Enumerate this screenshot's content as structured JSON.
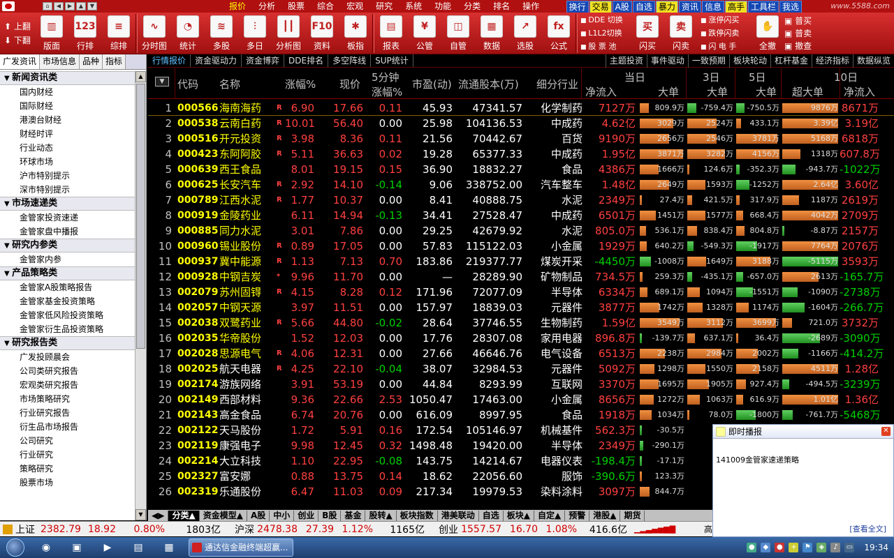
{
  "menubar": {
    "menus": [
      "报价",
      "分析",
      "股票",
      "综合",
      "宏观",
      "研究",
      "系统",
      "功能",
      "分类",
      "排名",
      "操作"
    ],
    "active_menu": "报价",
    "quick": [
      "换行",
      "交易",
      "A股",
      "自选",
      "暴力",
      "资讯",
      "信息",
      "高手",
      "工具栏",
      "我选"
    ],
    "site": "www.5588.com"
  },
  "toolbar": {
    "page_up": "上翻",
    "page_down": "下翻",
    "buttons": [
      {
        "label": "版面",
        "icon": "layout-icon"
      },
      {
        "label": "行排",
        "icon": "row-sort-icon"
      },
      {
        "label": "综排",
        "icon": "combined-sort-icon"
      },
      {
        "label": "分时图",
        "icon": "intraday-chart-icon"
      },
      {
        "label": "统计",
        "icon": "pie-stat-icon"
      },
      {
        "label": "多股",
        "icon": "multi-stock-icon"
      },
      {
        "label": "多日",
        "icon": "multi-day-icon"
      },
      {
        "label": "分析图",
        "icon": "candlestick-icon"
      },
      {
        "label": "资料",
        "icon": "f10-icon"
      },
      {
        "label": "板指",
        "icon": "sector-index-icon"
      },
      {
        "label": "报表",
        "icon": "report-icon"
      },
      {
        "label": "公管",
        "icon": "public-mgmt-icon"
      },
      {
        "label": "自管",
        "icon": "self-mgmt-icon"
      },
      {
        "label": "数据",
        "icon": "data-icon"
      },
      {
        "label": "选股",
        "icon": "stock-pick-icon"
      },
      {
        "label": "公式",
        "icon": "formula-icon"
      }
    ],
    "multi1": [
      "DDE 切换",
      "L1L2切换",
      "股 票 池"
    ],
    "buttons2": [
      {
        "label": "闪买",
        "icon": "flash-buy-icon",
        "glyph": "买"
      },
      {
        "label": "闪卖",
        "icon": "flash-sell-icon",
        "glyph": "卖"
      }
    ],
    "multi2": [
      "涨停闪买",
      "跌停闪卖",
      "闪 电 手"
    ],
    "button3": {
      "label": "全撤",
      "icon": "cancel-all-icon"
    },
    "trade": [
      "普买",
      "普卖",
      "撤查"
    ]
  },
  "sidebar": {
    "tabs": [
      "广发资讯",
      "市场信息",
      "品种",
      "指标"
    ],
    "sections": [
      {
        "title": "新闻资讯类",
        "items": [
          "国内财经",
          "国际财经",
          "港澳台财经",
          "财经时评",
          "行业动态",
          "环球市场",
          "沪市特别提示",
          "深市特别提示"
        ]
      },
      {
        "title": "市场速递类",
        "items": [
          "金管家投资速递",
          "金管家盘中播报"
        ]
      },
      {
        "title": "研究内参类",
        "items": [
          "金管家内参"
        ]
      },
      {
        "title": "产品策略类",
        "items": [
          "金管家A股策略报告",
          "金管家基金投资策略",
          "金管家低风险投资策略",
          "金管家衍生品投资策略"
        ]
      },
      {
        "title": "研究报告类",
        "items": [
          "广发投顾晨会",
          "公司类研究报告",
          "宏观类研究报告",
          "市场策略研究",
          "行业研究报告",
          "衍生品市场报告",
          "公司研究",
          "行业研究",
          "策略研究",
          "股票市场"
        ]
      }
    ]
  },
  "subtabs": [
    "行情报价",
    "资金驱动力",
    "资金博弈",
    "DDE排名",
    "多空阵线",
    "SUP统计"
  ],
  "subtabs_right": [
    "主题投资",
    "事件驱动",
    "一致预期",
    "板块轮动",
    "杠杆基金",
    "经济指标",
    "数据纵览"
  ],
  "table": {
    "headers": {
      "code": "代码",
      "name": "名称",
      "pct": "涨幅%",
      "price": "现价",
      "min5_top": "5分钟",
      "min5_bottom": "涨幅%",
      "pe": "市盈(动)",
      "float": "流通股本(万)",
      "industry": "细分行业",
      "today": "当日",
      "net": "净流入",
      "big": "大单",
      "d3": "3日",
      "d3big": "大单",
      "d5": "5日",
      "d5big": "大单",
      "d10": "10日",
      "superbig": "超大单",
      "net10": "净流入"
    },
    "rows": [
      {
        "no": "1",
        "code": "000566",
        "name": "海南海药",
        "tag": "R",
        "pct": "6.90",
        "price": "17.66",
        "m5": "0.11",
        "pe": "45.93",
        "float": "47341.57",
        "ind": "化学制药",
        "net": "7127万",
        "big": "809.9万",
        "d3": "-759.4万",
        "d5": "-750.5万",
        "sb": "9876万",
        "n10": "8671万"
      },
      {
        "no": "2",
        "code": "000538",
        "name": "云南白药",
        "tag": "R",
        "pct": "10.01",
        "price": "56.40",
        "m5": "0.00",
        "pe": "25.98",
        "float": "104136.53",
        "ind": "中成药",
        "net": "4.62亿",
        "big": "3029万",
        "d3": "2524万",
        "d5": "433.1万",
        "sb": "3.39亿",
        "n10": "3.19亿"
      },
      {
        "no": "3",
        "code": "000516",
        "name": "开元投资",
        "tag": "R",
        "pct": "3.98",
        "price": "8.36",
        "m5": "0.11",
        "pe": "21.56",
        "float": "70442.67",
        "ind": "百货",
        "net": "9190万",
        "big": "2656万",
        "d3": "2546万",
        "d5": "3781万",
        "sb": "5168万",
        "n10": "6818万"
      },
      {
        "no": "4",
        "code": "000423",
        "name": "东阿阿胶",
        "tag": "R",
        "pct": "5.11",
        "price": "36.63",
        "m5": "0.02",
        "pe": "19.28",
        "float": "65377.33",
        "ind": "中成药",
        "net": "1.95亿",
        "big": "3871万",
        "d3": "3282万",
        "d5": "4156万",
        "sb": "1318万",
        "n10": "607.8万"
      },
      {
        "no": "5",
        "code": "000639",
        "name": "西王食品",
        "tag": "",
        "pct": "8.01",
        "price": "19.15",
        "m5": "0.15",
        "pe": "36.90",
        "float": "18832.27",
        "ind": "食品",
        "net": "4386万",
        "big": "1666万",
        "d3": "124.6万",
        "d5": "-352.3万",
        "sb": "-943.7万",
        "n10": "-1022万"
      },
      {
        "no": "6",
        "code": "000625",
        "name": "长安汽车",
        "tag": "R",
        "pct": "2.92",
        "price": "14.10",
        "m5": "-0.14",
        "pe": "9.06",
        "float": "338752.00",
        "ind": "汽车整车",
        "net": "1.48亿",
        "big": "2649万",
        "d3": "1593万",
        "d5": "-1252万",
        "sb": "2.64亿",
        "n10": "3.60亿"
      },
      {
        "no": "7",
        "code": "000789",
        "name": "江西水泥",
        "tag": "R",
        "pct": "1.77",
        "price": "10.37",
        "m5": "0.00",
        "pe": "8.41",
        "float": "40888.75",
        "ind": "水泥",
        "net": "2349万",
        "big": "27.4万",
        "d3": "421.5万",
        "d5": "317.9万",
        "sb": "1187万",
        "n10": "2619万"
      },
      {
        "no": "8",
        "code": "000919",
        "name": "金陵药业",
        "tag": "",
        "pct": "6.11",
        "price": "14.94",
        "m5": "-0.13",
        "pe": "34.41",
        "float": "27528.47",
        "ind": "中成药",
        "net": "6501万",
        "big": "1451万",
        "d3": "1577万",
        "d5": "668.4万",
        "sb": "4042万",
        "n10": "2709万"
      },
      {
        "no": "9",
        "code": "000885",
        "name": "同力水泥",
        "tag": "",
        "pct": "3.01",
        "price": "7.86",
        "m5": "0.00",
        "pe": "29.25",
        "float": "42679.92",
        "ind": "水泥",
        "net": "805.0万",
        "big": "536.1万",
        "d3": "838.4万",
        "d5": "804.8万",
        "sb": "-8.87万",
        "n10": "2157万"
      },
      {
        "no": "10",
        "code": "000960",
        "name": "锡业股份",
        "tag": "R",
        "pct": "0.89",
        "price": "17.05",
        "m5": "0.00",
        "pe": "57.83",
        "float": "115122.03",
        "ind": "小金属",
        "net": "1929万",
        "big": "640.2万",
        "d3": "-549.3万",
        "d5": "-1917万",
        "sb": "7764万",
        "n10": "2076万"
      },
      {
        "no": "11",
        "code": "000937",
        "name": "冀中能源",
        "tag": "R",
        "pct": "1.13",
        "price": "7.13",
        "m5": "0.70",
        "pe": "183.86",
        "float": "219377.77",
        "ind": "煤炭开采",
        "net": "-4450万",
        "big": "-1008万",
        "d3": "1649万",
        "d5": "3188万",
        "sb": "-5115万",
        "n10": "3593万"
      },
      {
        "no": "12",
        "code": "000928",
        "name": "中钢吉炭",
        "tag": "*",
        "pct": "9.96",
        "price": "11.70",
        "m5": "0.00",
        "pe": "—",
        "float": "28289.90",
        "ind": "矿物制品",
        "net": "734.5万",
        "big": "259.3万",
        "d3": "-435.1万",
        "d5": "-657.0万",
        "sb": "2613万",
        "n10": "-165.7万"
      },
      {
        "no": "13",
        "code": "002079",
        "name": "苏州固锝",
        "tag": "R",
        "pct": "4.15",
        "price": "8.28",
        "m5": "0.12",
        "pe": "171.96",
        "float": "72077.09",
        "ind": "半导体",
        "net": "6334万",
        "big": "689.1万",
        "d3": "1094万",
        "d5": "-1551万",
        "sb": "-1090万",
        "n10": "-2738万"
      },
      {
        "no": "14",
        "code": "002057",
        "name": "中钢天源",
        "tag": "",
        "pct": "3.97",
        "price": "11.51",
        "m5": "0.00",
        "pe": "157.97",
        "float": "18839.03",
        "ind": "元器件",
        "net": "3877万",
        "big": "1742万",
        "d3": "1328万",
        "d5": "1174万",
        "sb": "-1604万",
        "n10": "-266.7万"
      },
      {
        "no": "15",
        "code": "002038",
        "name": "双鹭药业",
        "tag": "R",
        "pct": "5.66",
        "price": "44.80",
        "m5": "-0.02",
        "pe": "28.64",
        "float": "37746.55",
        "ind": "生物制药",
        "net": "1.59亿",
        "big": "3549万",
        "d3": "3112万",
        "d5": "3699万",
        "sb": "721.0万",
        "n10": "3732万"
      },
      {
        "no": "16",
        "code": "002035",
        "name": "华帝股份",
        "tag": "",
        "pct": "1.52",
        "price": "12.03",
        "m5": "0.00",
        "pe": "17.76",
        "float": "28307.08",
        "ind": "家用电器",
        "net": "896.8万",
        "big": "-139.7万",
        "d3": "637.1万",
        "d5": "36.4万",
        "sb": "-2689万",
        "n10": "-3090万"
      },
      {
        "no": "17",
        "code": "002028",
        "name": "思源电气",
        "tag": "R",
        "pct": "4.06",
        "price": "12.31",
        "m5": "0.00",
        "pe": "27.66",
        "float": "46646.76",
        "ind": "电气设备",
        "net": "6513万",
        "big": "2238万",
        "d3": "2984万",
        "d5": "2002万",
        "sb": "-1166万",
        "n10": "-414.2万"
      },
      {
        "no": "18",
        "code": "002025",
        "name": "航天电器",
        "tag": "R",
        "pct": "4.25",
        "price": "22.10",
        "m5": "-0.04",
        "pe": "38.07",
        "float": "32984.53",
        "ind": "元器件",
        "net": "5092万",
        "big": "1298万",
        "d3": "1550万",
        "d5": "2158万",
        "sb": "4511万",
        "n10": "1.28亿"
      },
      {
        "no": "19",
        "code": "002174",
        "name": "游族网络",
        "tag": "",
        "pct": "3.91",
        "price": "53.19",
        "m5": "0.00",
        "pe": "44.84",
        "float": "8293.99",
        "ind": "互联网",
        "net": "3370万",
        "big": "1695万",
        "d3": "1905万",
        "d5": "927.4万",
        "sb": "-494.5万",
        "n10": "-3239万"
      },
      {
        "no": "20",
        "code": "002149",
        "name": "西部材料",
        "tag": "",
        "pct": "9.36",
        "price": "22.66",
        "m5": "2.53",
        "pe": "1050.47",
        "float": "17463.00",
        "ind": "小金属",
        "net": "8656万",
        "big": "1272万",
        "d3": "1063万",
        "d5": "616.9万",
        "sb": "1.01亿",
        "n10": "1.36亿"
      },
      {
        "no": "21",
        "code": "002143",
        "name": "高金食品",
        "tag": "",
        "pct": "6.74",
        "price": "20.76",
        "m5": "0.00",
        "pe": "616.09",
        "float": "8997.95",
        "ind": "食品",
        "net": "1918万",
        "big": "1034万",
        "d3": "78.0万",
        "d5": "-1800万",
        "sb": "-761.7万",
        "n10": "-5468万"
      },
      {
        "no": "22",
        "code": "002122",
        "name": "天马股份",
        "tag": "",
        "pct": "1.72",
        "price": "5.91",
        "m5": "0.16",
        "pe": "172.54",
        "float": "105146.97",
        "ind": "机械基件",
        "net": "562.3万",
        "big": "-30.5万",
        "d3": "",
        "d5": "",
        "sb": "",
        "n10": ""
      },
      {
        "no": "23",
        "code": "002119",
        "name": "康强电子",
        "tag": "",
        "pct": "9.98",
        "price": "12.45",
        "m5": "0.32",
        "pe": "1498.48",
        "float": "19420.00",
        "ind": "半导体",
        "net": "2349万",
        "big": "-290.1万",
        "d3": "",
        "d5": "",
        "sb": "",
        "n10": ""
      },
      {
        "no": "24",
        "code": "002214",
        "name": "大立科技",
        "tag": "",
        "pct": "1.10",
        "price": "22.95",
        "m5": "-0.08",
        "pe": "143.75",
        "float": "14214.67",
        "ind": "电器仪表",
        "net": "-198.4万",
        "big": "-17.1万",
        "d3": "",
        "d5": "",
        "sb": "",
        "n10": ""
      },
      {
        "no": "25",
        "code": "002327",
        "name": "富安娜",
        "tag": "",
        "pct": "0.88",
        "price": "13.75",
        "m5": "0.14",
        "pe": "18.62",
        "float": "22056.60",
        "ind": "服饰",
        "net": "-390.6万",
        "big": "123.3万",
        "d3": "",
        "d5": "",
        "sb": "",
        "n10": ""
      },
      {
        "no": "26",
        "code": "002319",
        "name": "乐通股份",
        "tag": "",
        "pct": "6.47",
        "price": "11.03",
        "m5": "0.09",
        "pe": "217.34",
        "float": "19979.53",
        "ind": "染料涂料",
        "net": "3097万",
        "big": "844.7万",
        "d3": "",
        "d5": "",
        "sb": "",
        "n10": ""
      }
    ]
  },
  "bottom_tabs": [
    "分类▲",
    "资金模型▲",
    "A股",
    "中小",
    "创业",
    "B股",
    "基金",
    "股转▲",
    "板块指数",
    "港美联动",
    "自选",
    "板块▲",
    "自定▲",
    "预警",
    "港股▲",
    "期货"
  ],
  "status": {
    "sh_label": "上证",
    "sh_val": "2382.79",
    "sh_chg": "18.92",
    "sh_pct": "0.80%",
    "sh_amt": "1803亿",
    "hs_label": "沪深",
    "hs_val": "2478.38",
    "hs_chg": "27.39",
    "hs_pct": "1.12%",
    "hs_amt": "1165亿",
    "cy_label": "创业",
    "cy_val": "1557.57",
    "cy_chg": "16.70",
    "cy_pct": "1.08%",
    "cy_amt": "416.6亿",
    "extra": "高级行情.上"
  },
  "popup": {
    "title": "即时播报",
    "message": "141009金管家速递策略",
    "more": "[查看全文]"
  },
  "taskbar": {
    "app": "通达信金融终端超赢...",
    "time": "19:34"
  }
}
